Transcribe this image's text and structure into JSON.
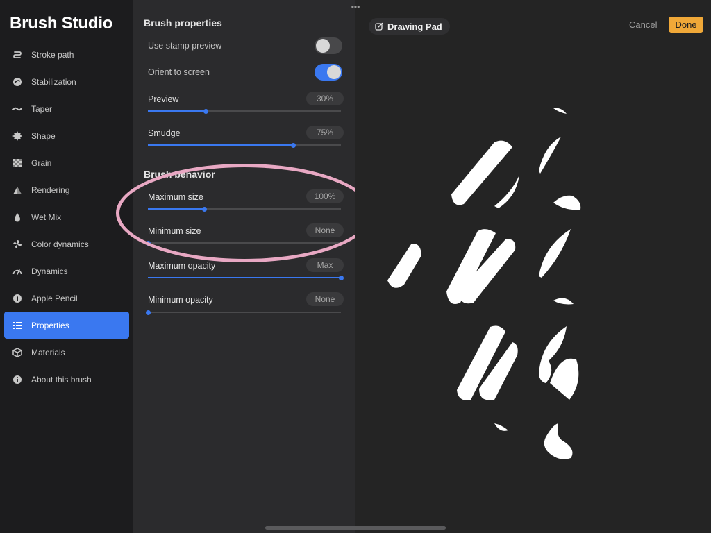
{
  "sidebar": {
    "title": "Brush Studio",
    "items": [
      {
        "label": "Stroke path",
        "icon": "stroke-path-icon"
      },
      {
        "label": "Stabilization",
        "icon": "stabilization-icon"
      },
      {
        "label": "Taper",
        "icon": "taper-icon"
      },
      {
        "label": "Shape",
        "icon": "shape-icon"
      },
      {
        "label": "Grain",
        "icon": "grain-icon"
      },
      {
        "label": "Rendering",
        "icon": "rendering-icon"
      },
      {
        "label": "Wet Mix",
        "icon": "wet-mix-icon"
      },
      {
        "label": "Color dynamics",
        "icon": "color-dynamics-icon"
      },
      {
        "label": "Dynamics",
        "icon": "dynamics-icon"
      },
      {
        "label": "Apple Pencil",
        "icon": "apple-pencil-icon"
      },
      {
        "label": "Properties",
        "icon": "properties-icon",
        "active": true
      },
      {
        "label": "Materials",
        "icon": "materials-icon"
      },
      {
        "label": "About this brush",
        "icon": "info-icon"
      }
    ]
  },
  "panel": {
    "brush_properties": {
      "title": "Brush properties",
      "use_stamp_preview": {
        "label": "Use stamp preview",
        "on": false
      },
      "orient_to_screen": {
        "label": "Orient to screen",
        "on": true
      },
      "preview": {
        "label": "Preview",
        "value": "30%",
        "fraction": 0.3
      },
      "smudge": {
        "label": "Smudge",
        "value": "75%",
        "fraction": 0.75
      }
    },
    "brush_behavior": {
      "title": "Brush behavior",
      "maximum_size": {
        "label": "Maximum size",
        "value": "100%",
        "fraction": 0.29
      },
      "minimum_size": {
        "label": "Minimum size",
        "value": "None",
        "fraction": 0.0
      },
      "maximum_opacity": {
        "label": "Maximum opacity",
        "value": "Max",
        "fraction": 1.0
      },
      "minimum_opacity": {
        "label": "Minimum opacity",
        "value": "None",
        "fraction": 0.0
      }
    }
  },
  "canvas": {
    "drawing_pad_label": "Drawing Pad",
    "cancel_label": "Cancel",
    "done_label": "Done",
    "more_label": "•••"
  },
  "colors": {
    "accent": "#3a78f0",
    "done": "#f0a838",
    "highlight_ring": "#e8a8c3"
  }
}
